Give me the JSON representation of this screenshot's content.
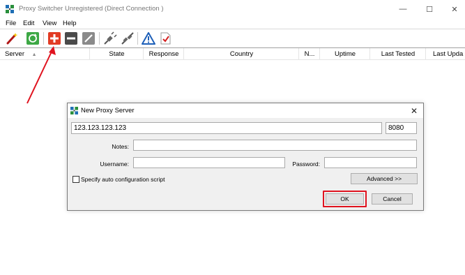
{
  "window": {
    "title": "Proxy Switcher Unregistered (Direct Connection )",
    "app_icon": "proxy-switcher-grid-icon",
    "controls": {
      "minimize": "—",
      "maximize": "☐",
      "close": "✕"
    }
  },
  "menu": {
    "items": [
      "File",
      "Edit",
      "View",
      "Help"
    ]
  },
  "toolbar": {
    "buttons": [
      "magic-wand-icon",
      "refresh-icon",
      "add-proxy-icon",
      "remove-proxy-icon",
      "edit-proxy-icon",
      "connect-plug-icon",
      "disconnect-plug-icon",
      "warning-icon",
      "check-document-icon"
    ]
  },
  "columns": {
    "server": "Server",
    "sort_indicator": "▲",
    "state": "State",
    "response": "Response",
    "country": "Country",
    "n": "N...",
    "uptime": "Uptime",
    "last_tested": "Last Tested",
    "last_updated": "Last Upda"
  },
  "dialog": {
    "title": "New Proxy Server",
    "close": "✕",
    "host_value": "123.123.123.123",
    "port_value": "8080",
    "notes_label": "Notes:",
    "notes_value": "",
    "username_label": "Username:",
    "username_value": "",
    "password_label": "Password:",
    "password_value": "",
    "checkbox_label": "Specify auto configuration script",
    "checkbox_checked": false,
    "advanced_button": "Advanced >>",
    "ok_button": "OK",
    "cancel_button": "Cancel"
  },
  "colors": {
    "annotation_red": "#e0131f",
    "dialog_bg": "#f0f0f0",
    "button_bg": "#e1e1e1"
  }
}
